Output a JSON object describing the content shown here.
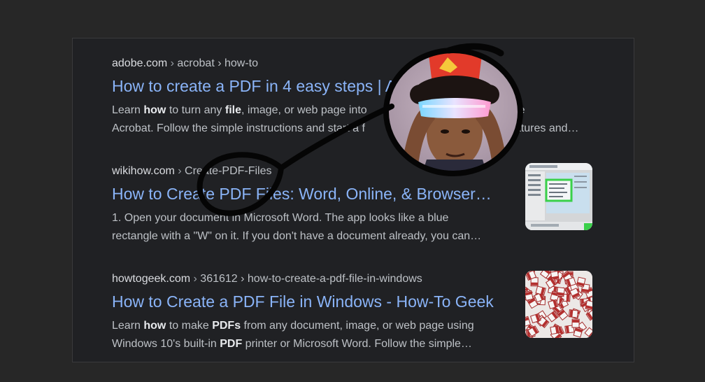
{
  "results": [
    {
      "domain": "adobe.com",
      "path": "acrobat › how-to",
      "title": "How to create a PDF in 4 easy steps | A",
      "snippet_line1": [
        "Learn ",
        "how",
        " to turn any ",
        "file",
        ", image, or web page into",
        " Adobe"
      ],
      "snippet_line2": "Acrobat. Follow the simple instructions and start a f",
      "snippet_line2_tail": "atures and…"
    },
    {
      "domain": "wikihow.com",
      "path": "Create-PDF-Files",
      "title": "How to Create PDF Files: Word, Online, & Browser…",
      "snippet_line1": "1. Open your document in Microsoft Word. The app looks like a blue",
      "snippet_line2": "rectangle with a \"W\" on it. If you don't have a document already, you can…"
    },
    {
      "domain": "howtogeek.com",
      "path": "361612 › how-to-create-a-pdf-file-in-windows",
      "title": "How to Create a PDF File in Windows - How-To Geek",
      "snippet_line1": [
        "Learn ",
        "how",
        " to make ",
        "PDFs",
        " from any document, image, or web page using"
      ],
      "snippet_line2": [
        "Windows 10's built-in ",
        "PDF",
        " printer or Microsoft Word. Follow the simple…"
      ]
    }
  ],
  "colors": {
    "background": "#272727",
    "panel": "#202124",
    "link": "#8ab4f8",
    "text": "#bdc1c6"
  },
  "icons": {
    "thumb_1": "file-explorer-screenshot-thumbnail",
    "thumb_2": "pdf-icons-pattern-thumbnail",
    "overlay": "magnifying-glass-face-sticker"
  }
}
